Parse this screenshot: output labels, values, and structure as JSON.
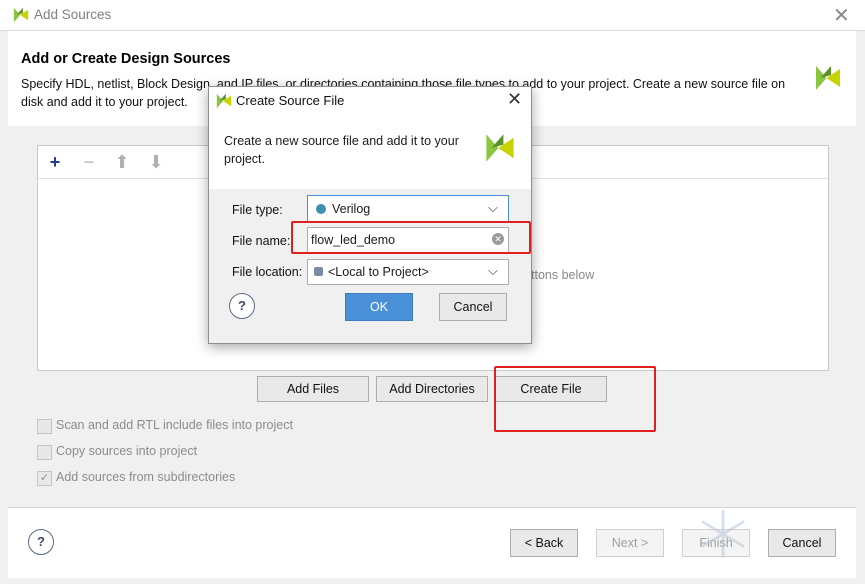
{
  "window": {
    "title": "Add Sources"
  },
  "header": {
    "heading": "Add or Create Design Sources",
    "description": "Specify HDL, netlist, Block Design, and IP files, or directories containing those file types to add to your project. Create a new source file on disk and add it to your project."
  },
  "list": {
    "hint_fragment": "ttons below"
  },
  "actions": {
    "add_files": "Add Files",
    "add_directories": "Add Directories",
    "create_file": "Create File"
  },
  "options": [
    {
      "label": "Scan and add RTL include files into project",
      "checked": false
    },
    {
      "label": "Copy sources into project",
      "checked": false
    },
    {
      "label": "Add sources from subdirectories",
      "checked": true
    }
  ],
  "footer": {
    "help": "?",
    "back": "< Back",
    "next": "Next >",
    "finish": "Finish",
    "cancel": "Cancel"
  },
  "dialog": {
    "title": "Create Source File",
    "description": "Create a new source file and add it to your project.",
    "file_type_label": "File type:",
    "file_type_value": "Verilog",
    "file_name_label": "File name:",
    "file_name_value": "flow_led_demo",
    "file_location_label": "File location:",
    "file_location_value": "<Local to Project>",
    "help": "?",
    "ok": "OK",
    "cancel": "Cancel"
  },
  "colors": {
    "accent": "#4a90d9",
    "highlight": "#e02020",
    "verilog_dot": "#3e8fb0"
  },
  "icons": {
    "app": "vivado-logo-icon",
    "close": "close-icon",
    "add": "plus-icon",
    "remove": "minus-icon",
    "up": "arrow-up-icon",
    "down": "arrow-down-icon",
    "dropdown": "chevron-down-icon",
    "clear": "clear-icon"
  }
}
